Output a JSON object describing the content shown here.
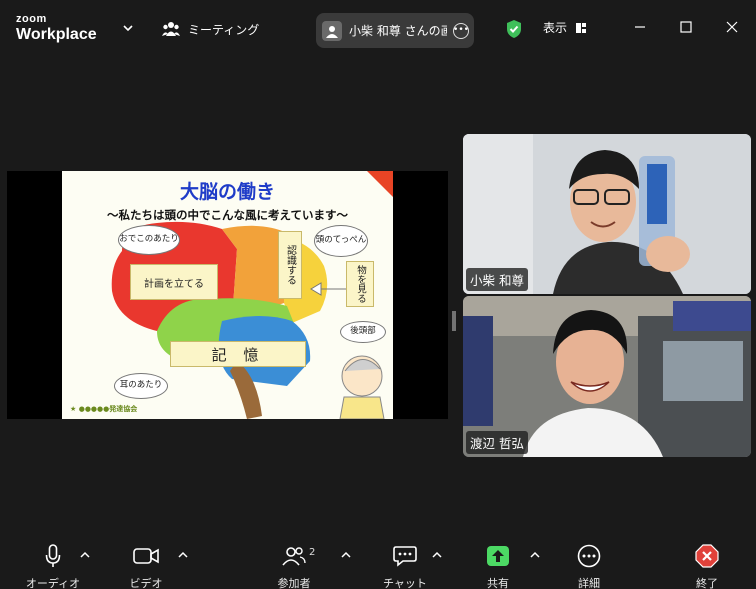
{
  "titlebar": {
    "brand_top": "zoom",
    "brand_bottom": "Workplace",
    "meeting_label": "ミーティング",
    "host_label": "小柴 和尊 さんの画面",
    "view_label": "表示"
  },
  "slide": {
    "title": "大脳の働き",
    "subtitle": "〜私たちは頭の中でこんな風に考えています〜",
    "labels": {
      "plan": "計画を立てる",
      "recognize": "認識する",
      "see": "物を見る",
      "memory": "記 憶",
      "forehead": "おでこのあたり",
      "crown": "頭のてっぺん",
      "occipital": "後頭部",
      "ear": "耳のあたり"
    },
    "credit": "★ ●●●●●発達協会"
  },
  "participants": [
    {
      "name": "小柴 和尊"
    },
    {
      "name": "渡辺 哲弘"
    }
  ],
  "toolbar": {
    "audio": "オーディオ",
    "video": "ビデオ",
    "participants": "参加者",
    "participants_count": "2",
    "chat": "チャット",
    "share": "共有",
    "details": "詳細",
    "end": "終了"
  },
  "colors": {
    "share_green": "#4cd964",
    "end_red": "#e0413a",
    "shield_green": "#3fbf5a",
    "slide_title_blue": "#1f3cc8"
  }
}
